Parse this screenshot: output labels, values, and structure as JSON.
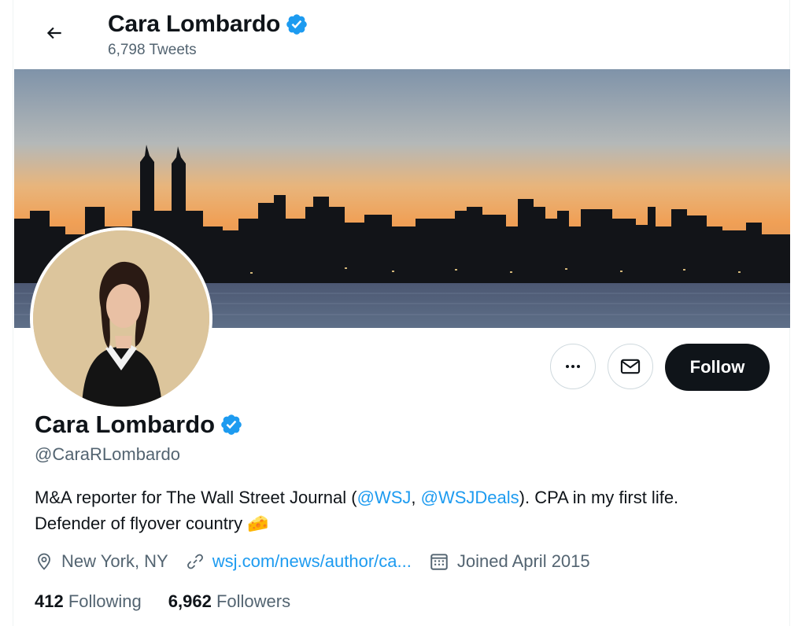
{
  "header": {
    "name": "Cara Lombardo",
    "tweet_count": "6,798 Tweets"
  },
  "profile": {
    "name": "Cara Lombardo",
    "handle": "@CaraRLombardo",
    "bio": {
      "part1": "M&A reporter for The Wall Street Journal (",
      "mention1": "@WSJ",
      "sep": ", ",
      "mention2": "@WSJDeals",
      "part2": "). CPA in my first life.",
      "line2": "Defender of flyover country",
      "emoji": "🧀"
    },
    "location": "New York, NY",
    "website": "wsj.com/news/author/ca...",
    "joined": "Joined April 2015",
    "following_count": "412",
    "following_label": "Following",
    "followers_count": "6,962",
    "followers_label": "Followers"
  },
  "actions": {
    "follow_label": "Follow"
  },
  "colors": {
    "accent": "#1d9bf0",
    "text": "#0f1419",
    "secondary": "#536471",
    "button_dark": "#0f1419"
  },
  "icons": [
    "back-arrow-icon",
    "verified-badge-icon",
    "more-icon",
    "mail-icon",
    "location-icon",
    "link-icon",
    "calendar-icon"
  ]
}
